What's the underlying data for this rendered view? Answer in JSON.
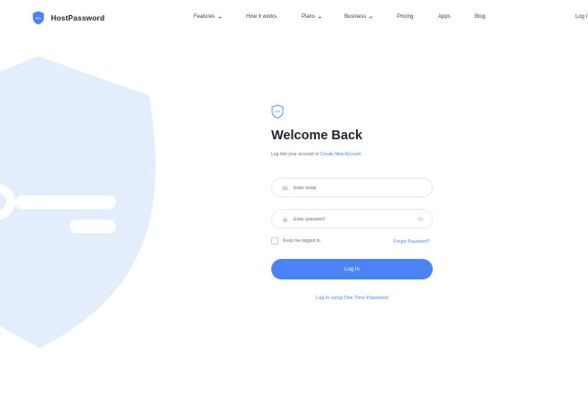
{
  "brand": {
    "name": "HostPassword",
    "logo_text": "Onu"
  },
  "nav": {
    "items": [
      {
        "label": "Features",
        "has_dropdown": true
      },
      {
        "label": "How it works",
        "has_dropdown": false
      },
      {
        "label": "Plans",
        "has_dropdown": true
      },
      {
        "label": "Business",
        "has_dropdown": true
      },
      {
        "label": "Pricing",
        "has_dropdown": false
      },
      {
        "label": "Apps",
        "has_dropdown": false
      },
      {
        "label": "Blog",
        "has_dropdown": false
      }
    ],
    "login": "Log I"
  },
  "login_form": {
    "icon_text": "Onu",
    "title": "Welcome Back",
    "subtitle": "Log into your account or",
    "create_account_link": "Create New Account",
    "email": {
      "value": "",
      "placeholder": "Enter email"
    },
    "password": {
      "value": "",
      "placeholder": "Enter password"
    },
    "remember_label": "Keep me logged in",
    "remember_checked": false,
    "forgot_link": "Forgot Password?",
    "submit_label": "Log In",
    "otp_link": "Log in using One Time Password"
  },
  "colors": {
    "accent": "#4a83f5",
    "illustration": "#e4edfc"
  },
  "icons": {
    "logo": "shield-icon",
    "chevron": "chevron-down-icon",
    "email": "envelope-icon",
    "password": "lock-icon",
    "reveal": "eye-icon"
  }
}
